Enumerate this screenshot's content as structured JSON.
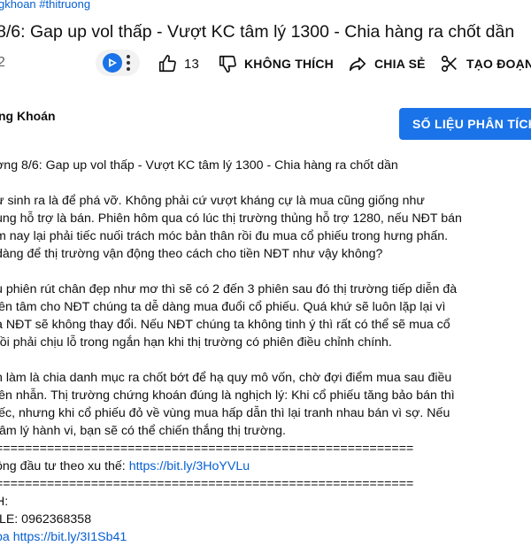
{
  "hashtags": "gkhoan #thitruong",
  "title": "8/6: Gap up vol thấp - Vượt KC tâm lý 1300 - Chia hàng ra chốt dần",
  "left_fragment": "2",
  "actions": {
    "like_count": "13",
    "dislike_label": "KHÔNG THÍCH",
    "share_label": "CHIA SẺ",
    "clip_label": "TẠO ĐOẠN"
  },
  "channel_name": "ng Khoán",
  "cta_label": "SỐ LIỆU PHÂN TÍCH",
  "description": {
    "p1": [
      "ơng 8/6: Gap up vol thấp - Vượt KC tâm lý 1300 - Chia hàng ra chốt dần"
    ],
    "p2": [
      "ự sinh ra là để phá vỡ. Không phải cứ vượt kháng cự là mua cũng giống như",
      "ung hỗ trợ là bán. Phiên hôm qua có lúc thị trường thủng hỗ trợ 1280, nếu NĐT bán",
      "m nay lại phải tiếc nuối trách móc bản thân rồi đu mua cổ phiếu trong hưng phấn.",
      "dàng để thị trường vận động theo cách cho tiền NĐT như vậy không?"
    ],
    "p3": [
      "u phiên rút chân đẹp như mơ thì sẽ có 2 đến 3 phiên sau đó thị trường tiếp diễn đà",
      "iên tâm cho NĐT chúng ta dễ dàng mua đuổi cổ phiếu. Quá khứ sẽ luôn lặp lại vì",
      "a NĐT sẽ không thay đổi. Nếu NĐT chúng ta không tinh ý thì rất có thể sẽ mua cổ",
      "rồi phải chịu lỗ trong ngắn hạn khi thị trường có phiên điều chỉnh chính."
    ],
    "p4": [
      "n làm là chia danh mục ra chốt bớt để hạ quy mô vốn, chờ đợi điểm mua sau điều",
      "iên nhẫn. Thị trường chứng khoán đúng là nghịch lý: Khi cổ phiếu tăng bảo bán thì",
      "iếc, nhưng khi cổ phiếu đỏ về vùng mua hấp dẫn thì lại tranh nhau bán vì sợ. Nếu",
      "tâm lý hành vi, bạn sẽ có thể chiến thắng thị trường."
    ],
    "separator1": "=========================================================",
    "invest_prefix": "ồng đầu tư theo xu thế: ",
    "invest_link": "https://bit.ly/3HoYVLu",
    "separator2": "=========================================================",
    "contact_h": "H:",
    "mobile": "ILE: 0962368358",
    "cutoff": "ba  https://bit.ly/3I1Sb41"
  }
}
